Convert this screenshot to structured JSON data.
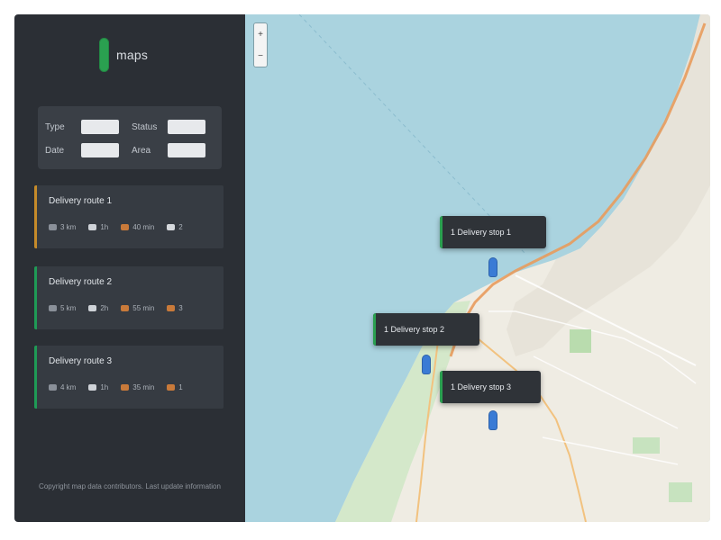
{
  "app": {
    "name": "maps"
  },
  "filters": {
    "row1": [
      {
        "label": "Type",
        "value": ""
      },
      {
        "label": "Status",
        "value": ""
      }
    ],
    "row2": [
      {
        "label": "Date",
        "value": ""
      },
      {
        "label": "Area",
        "value": ""
      }
    ]
  },
  "cards": [
    {
      "title": "Delivery route 1",
      "accent": "#c58b2a",
      "meta": [
        "3 km",
        "1h",
        "40 min",
        "2"
      ]
    },
    {
      "title": "Delivery route 2",
      "accent": "#1f9a56",
      "meta": [
        "5 km",
        "2h",
        "55 min",
        "3"
      ]
    },
    {
      "title": "Delivery route 3",
      "accent": "#1f9a56",
      "meta": [
        "4 km",
        "1h",
        "35 min",
        "1"
      ]
    }
  ],
  "footer": {
    "text": "Copyright map data contributors. Last update information"
  },
  "map": {
    "zoom_in": "+",
    "zoom_out": "−",
    "popups": [
      {
        "label": "1 Delivery stop 1"
      },
      {
        "label": "1 Delivery stop 2"
      },
      {
        "label": "1 Delivery stop 3"
      }
    ]
  },
  "colors": {
    "accent_green": "#2aa050",
    "pin_blue": "#3a7bd5",
    "water": "#aad3df",
    "land": "#f0efe7"
  }
}
